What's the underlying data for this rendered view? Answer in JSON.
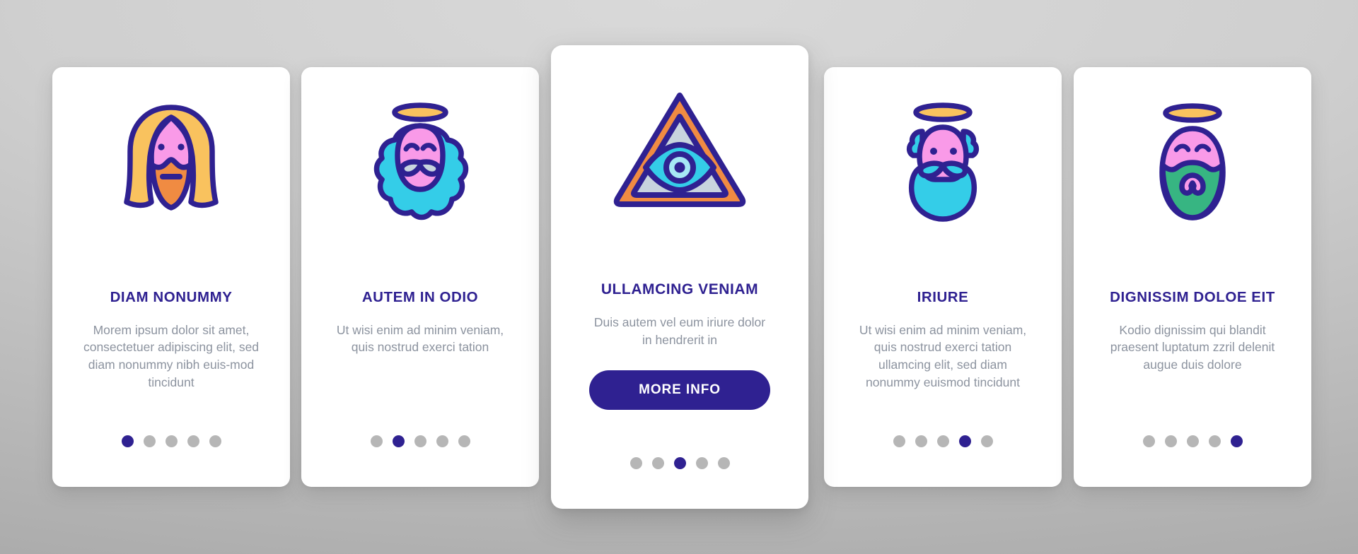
{
  "theme": {
    "accent": "#2f2191",
    "body_text": "#8c939f",
    "card_bg": "#ffffff",
    "dot_inactive": "#b6b6b6",
    "dot_active": "#2f2191",
    "background_start": "#d9d9d9",
    "background_end": "#a6a6a6"
  },
  "cards": [
    {
      "id": "card-1",
      "icon_name": "long-haired-bearded-man-icon",
      "title": "DIAM NONUMMY",
      "body": "Morem ipsum dolor sit amet, consectetuer adipiscing elit, sed diam nonummy nibh euis-mod tincidunt",
      "dots_total": 5,
      "dot_active_index": 0,
      "featured": false,
      "has_button": false
    },
    {
      "id": "card-2",
      "icon_name": "haloed-bearded-saint-icon",
      "title": "AUTEM IN ODIO",
      "body": "Ut wisi enim ad minim veniam, quis nostrud exerci tation",
      "dots_total": 5,
      "dot_active_index": 1,
      "featured": false,
      "has_button": false
    },
    {
      "id": "card-3",
      "icon_name": "all-seeing-eye-triangle-icon",
      "title": "ULLAMCING VENIAM",
      "body": "Duis autem vel eum iriure dolor in hendrerit in",
      "button_label": "MORE INFO",
      "dots_total": 5,
      "dot_active_index": 2,
      "featured": true,
      "has_button": true
    },
    {
      "id": "card-4",
      "icon_name": "haloed-man-cyan-beard-icon",
      "title": "IRIURE",
      "body": "Ut wisi enim ad minim veniam, quis nostrud exerci tation ullamcing elit, sed diam nonummy euismod tincidunt",
      "dots_total": 5,
      "dot_active_index": 3,
      "featured": false,
      "has_button": false
    },
    {
      "id": "card-5",
      "icon_name": "haloed-man-green-beard-icon",
      "title": "DIGNISSIM DOLOE EIT",
      "body": "Kodio dignissim qui blandit praesent luptatum zzril delenit augue duis dolore",
      "dots_total": 5,
      "dot_active_index": 4,
      "featured": false,
      "has_button": false
    }
  ]
}
